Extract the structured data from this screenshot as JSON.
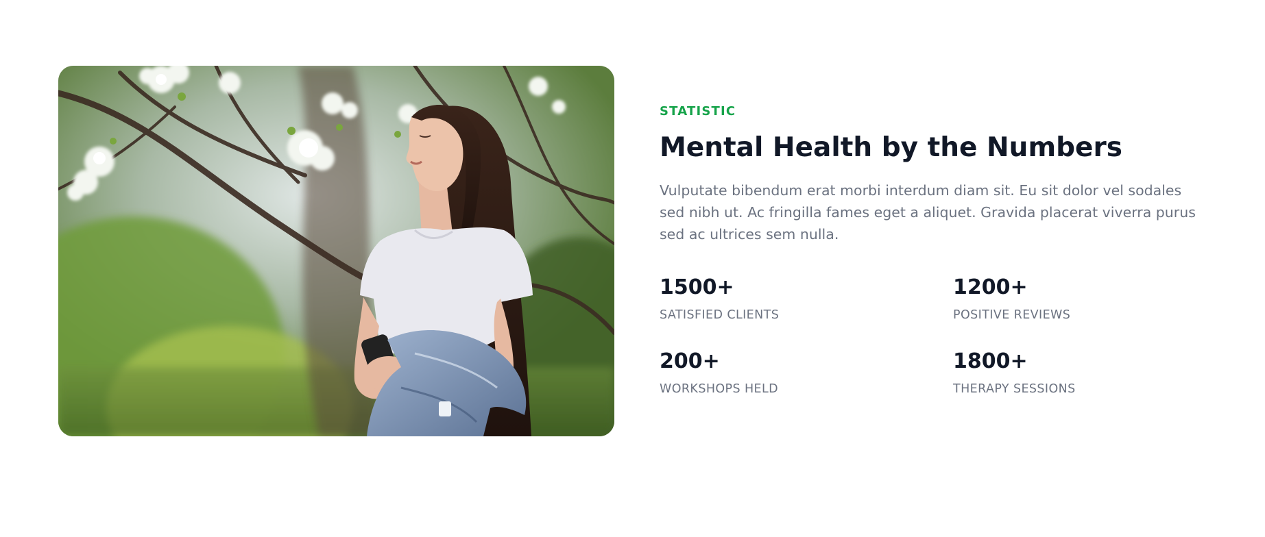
{
  "section": {
    "eyebrow": "STATISTIC",
    "title": "Mental Health by the Numbers",
    "description": "Vulputate bibendum erat morbi interdum diam sit. Eu sit dolor vel sodales sed nibh ut. Ac fringilla fames eget a aliquet. Gravida placerat viverra purus sed ac ultrices sem nulla."
  },
  "stats": [
    {
      "value": "1500+",
      "label": "SATISFIED CLIENTS"
    },
    {
      "value": "1200+",
      "label": "POSITIVE REVIEWS"
    },
    {
      "value": "200+",
      "label": "WORKSHOPS HELD"
    },
    {
      "value": "1800+",
      "label": "THERAPY SESSIONS"
    }
  ],
  "colors": {
    "accent": "#16a34a",
    "heading": "#111827",
    "muted": "#6b7280"
  },
  "image": {
    "icon": "woman-in-blossoming-park-photo"
  }
}
